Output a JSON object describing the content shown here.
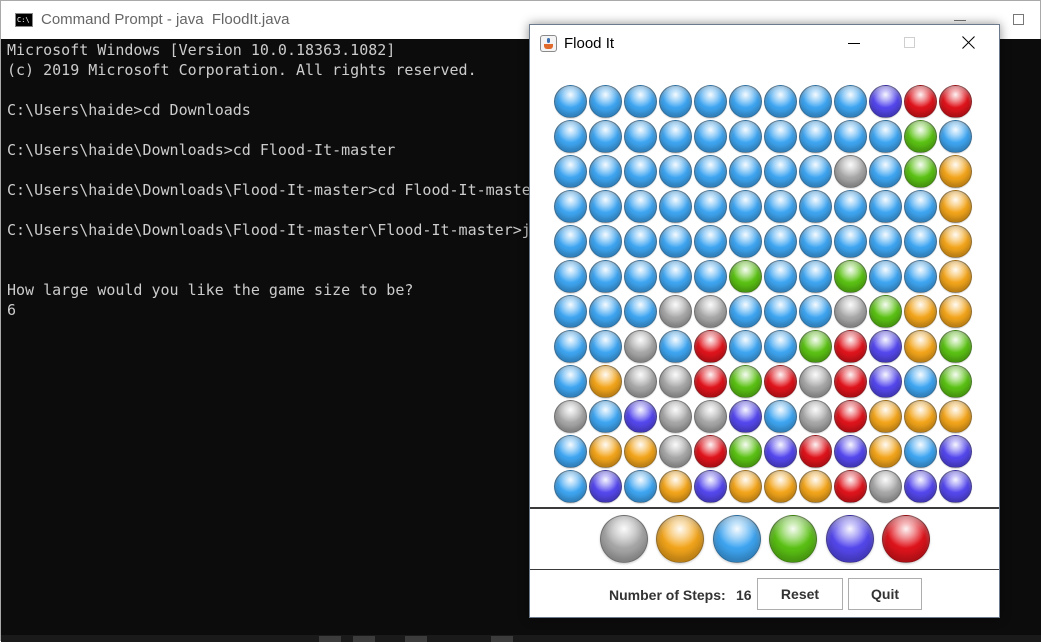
{
  "cmd": {
    "title": "Command Prompt - java  FloodIt.java",
    "icon": "console-icon",
    "lines": [
      "Microsoft Windows [Version 10.0.18363.1082]",
      "(c) 2019 Microsoft Corporation. All rights reserved.",
      "",
      "C:\\Users\\haide>cd Downloads",
      "",
      "C:\\Users\\haide\\Downloads>cd Flood-It-master",
      "",
      "C:\\Users\\haide\\Downloads\\Flood-It-master>cd Flood-It-master",
      "",
      "C:\\Users\\haide\\Downloads\\Flood-It-master\\Flood-It-master>java FloodIt.java",
      "",
      "",
      "How large would you like the game size to be?",
      "6"
    ]
  },
  "flood": {
    "title": "Flood It",
    "icon": "java-icon",
    "colors": {
      "B": "#3fa6f2",
      "P": "#5548ee",
      "R": "#e0141c",
      "G": "#5bc214",
      "S": "#a8a8a8",
      "O": "#f3a51b"
    },
    "grid": [
      "BBBBBBBBBPRR",
      "BBBBBBBBBBGB",
      "BBBBBBBBSBGO",
      "BBBBBBBBBBBO",
      "BBBBBBBBBBBO",
      "BBBBBGBBGBBO",
      "BBBSSBBBSGOO",
      "BBSBRBBGRPOG",
      "BOSSRGRSRPBG",
      "SBPSSPBSROOO",
      "BOOSRGPRPOBP",
      "BPBOPOOORSPP"
    ],
    "palette": [
      "S",
      "O",
      "B",
      "G",
      "P",
      "R"
    ],
    "steps_label": "Number of Steps:",
    "steps": "16",
    "reset_label": "Reset",
    "quit_label": "Quit"
  }
}
